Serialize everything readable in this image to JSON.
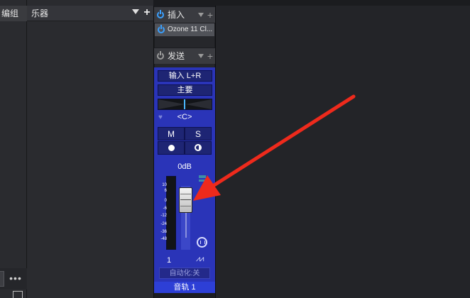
{
  "left_panel": {
    "header_label": "编组",
    "more_label": "•••"
  },
  "instruments_panel": {
    "header_label": "乐器",
    "add_label": "+"
  },
  "channel": {
    "inserts": {
      "header_label": "插入",
      "plus_label": "+",
      "slot_label": "Ozone 11 Cl..."
    },
    "sends": {
      "header_label": "发送",
      "plus_label": "+"
    },
    "input_label": "输入 L+R",
    "output_label": "主要",
    "pan_value": "<C>",
    "mute_label": "M",
    "solo_label": "S",
    "volume_readout": "0dB",
    "meter_scale": [
      "10",
      "6",
      "0",
      "-6",
      "-12",
      "-24",
      "-36",
      "-48"
    ],
    "channel_number": "1",
    "automation_label": "自动化:关",
    "track_name": "音轨 1",
    "colors": {
      "strip_body": "#2a34b8",
      "power_on": "#3aa0ff",
      "annotation_arrow": "#ee2a1c"
    }
  }
}
